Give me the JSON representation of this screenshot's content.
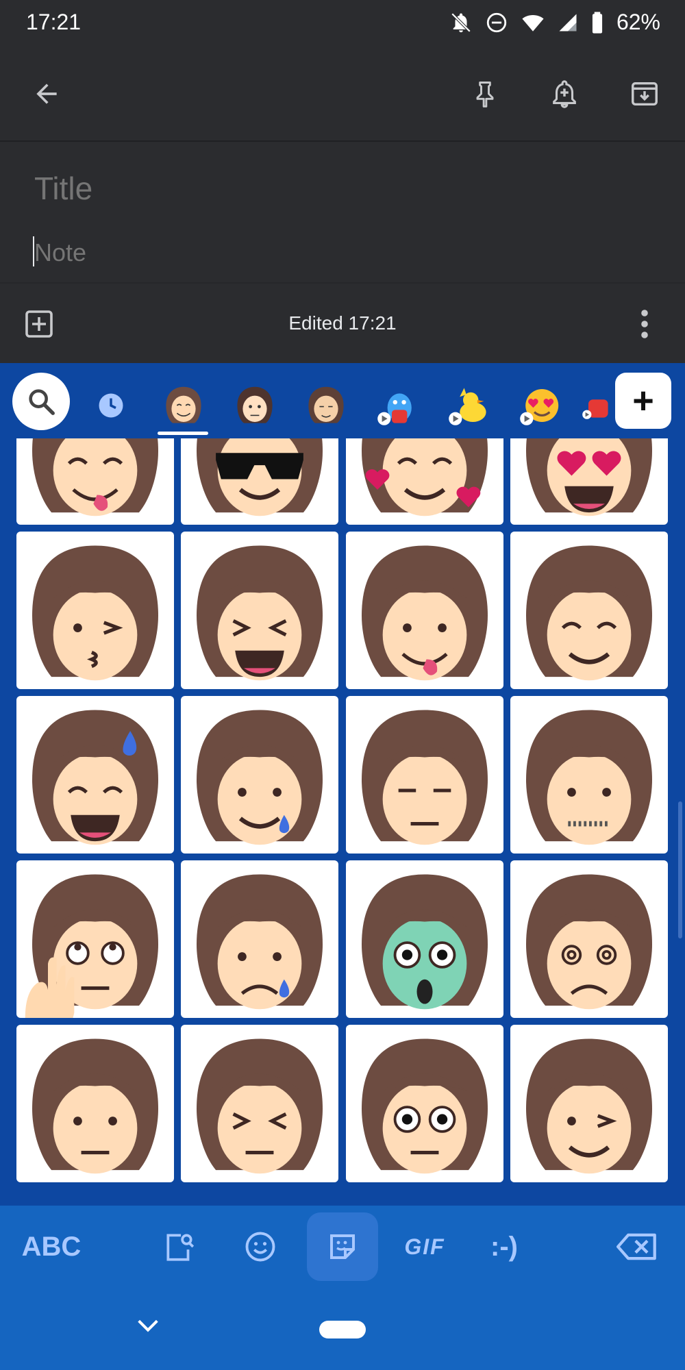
{
  "status_bar": {
    "time": "17:21",
    "battery": "62%",
    "icons": [
      "do-not-disturb-icon",
      "notifications-off-icon",
      "wifi-icon",
      "signal-icon",
      "battery-icon"
    ]
  },
  "app_bar": {
    "back": "back-arrow-icon",
    "actions": [
      "pin-icon",
      "reminder-icon",
      "archive-icon"
    ]
  },
  "editor": {
    "title_placeholder": "Title",
    "note_placeholder": "Note",
    "title_value": "",
    "note_value": ""
  },
  "bottom_bar": {
    "edited_text": "Edited 17:21",
    "add": "add-box-icon",
    "more": "more-vert-icon"
  },
  "keyboard": {
    "accent": "#0d47a1",
    "tabs": [
      {
        "name": "search-icon"
      },
      {
        "name": "recent-icon"
      },
      {
        "name": "bitmoji-avatar-1",
        "selected": true
      },
      {
        "name": "bitmoji-avatar-2"
      },
      {
        "name": "bitmoji-avatar-3"
      },
      {
        "name": "animated-bird-sticker"
      },
      {
        "name": "animated-duck-sticker"
      },
      {
        "name": "animated-heart-eyes-sticker"
      },
      {
        "name": "animated-party-sticker"
      }
    ],
    "add_label": "+",
    "stickers": [
      "yum",
      "sunglasses",
      "smiling-hearts",
      "heart-eyes",
      "kissing-wink",
      "laughing",
      "tongue-out",
      "blushing-smile",
      "sweat-smile",
      "tear-smile",
      "expressionless",
      "zipper-mouth",
      "face-palm-hand",
      "sad-tear",
      "screaming",
      "dizzy",
      "worried",
      "squinting",
      "big-eyes",
      "winking"
    ],
    "bottom_row": {
      "abc": "ABC",
      "gif": "GIF",
      "emoticon": ":-)"
    }
  }
}
